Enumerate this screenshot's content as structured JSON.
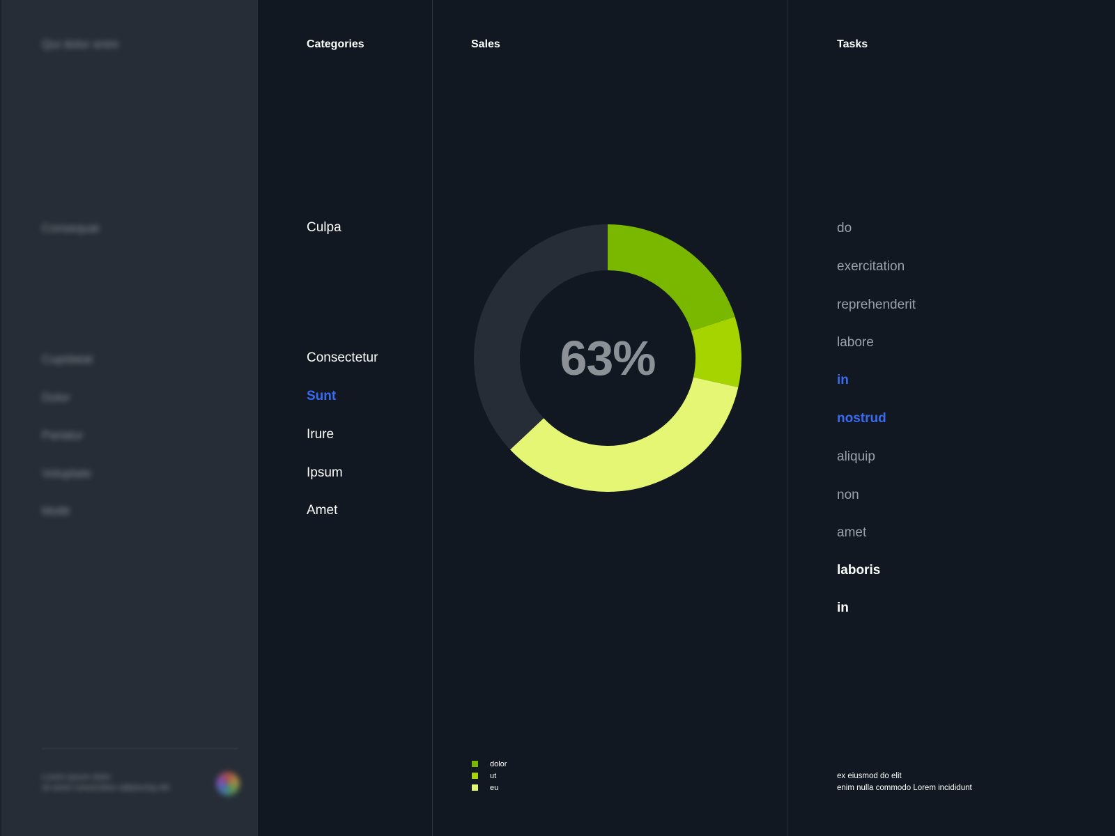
{
  "sidebar": {
    "brand": "Qui dolor enim",
    "section_label": "Consequat",
    "nav": [
      {
        "label": "Cupidatat"
      },
      {
        "label": "Dolor"
      },
      {
        "label": "Pariatur"
      },
      {
        "label": "Voluptate"
      },
      {
        "label": "Mollit"
      }
    ],
    "footer_line1": "Lorem ipsum dolor",
    "footer_line2": "sit amet consectetur adipiscing elit"
  },
  "categories": {
    "title": "Categories",
    "items": [
      {
        "label": "Culpa",
        "active": false
      },
      {
        "label": "Consectetur",
        "active": false
      },
      {
        "label": "Sunt",
        "active": true
      },
      {
        "label": "Irure",
        "active": false
      },
      {
        "label": "Ipsum",
        "active": false
      },
      {
        "label": "Amet",
        "active": false
      }
    ]
  },
  "sales": {
    "title": "Sales",
    "center_value": "63%",
    "track_color": "#262d36",
    "legend": [
      {
        "label": "dolor",
        "color": "#7ab800"
      },
      {
        "label": "ut",
        "color": "#a6d400"
      },
      {
        "label": "eu",
        "color": "#e4f673"
      }
    ]
  },
  "chart_data": {
    "type": "pie",
    "variant": "donut",
    "center_label": "63%",
    "series": [
      {
        "name": "dolor",
        "value": 20,
        "color": "#7ab800"
      },
      {
        "name": "ut",
        "value": 8.5,
        "color": "#a6d400"
      },
      {
        "name": "eu",
        "value": 34.5,
        "color": "#e4f673"
      }
    ],
    "remainder": {
      "value": 37,
      "color": "#262d36"
    },
    "total": 100
  },
  "tasks": {
    "title": "Tasks",
    "items": [
      {
        "label": "do",
        "style": "muted"
      },
      {
        "label": "exercitation",
        "style": "muted"
      },
      {
        "label": "reprehenderit",
        "style": "muted"
      },
      {
        "label": "labore",
        "style": "muted"
      },
      {
        "label": "in",
        "style": "highlight"
      },
      {
        "label": "nostrud",
        "style": "highlight"
      },
      {
        "label": "aliquip",
        "style": "muted"
      },
      {
        "label": "non",
        "style": "muted"
      },
      {
        "label": "amet",
        "style": "muted"
      },
      {
        "label": "laboris",
        "style": "strong"
      },
      {
        "label": "in",
        "style": "strong"
      }
    ],
    "footer_line1": "ex eiusmod do elit",
    "footer_line2": "enim nulla commodo Lorem incididunt"
  }
}
